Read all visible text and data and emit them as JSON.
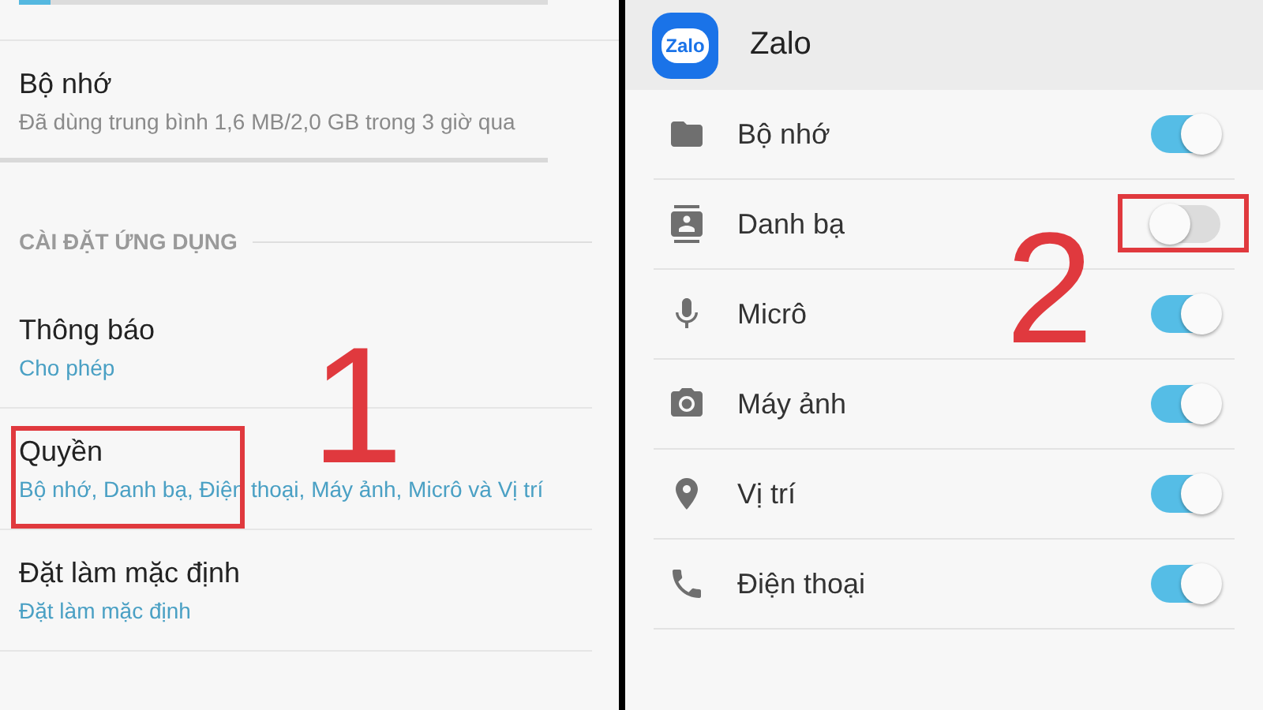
{
  "left_panel": {
    "usage_bar": {
      "level": 0.06
    },
    "items": [
      {
        "kind": "stat",
        "title": "Bộ nhớ",
        "subtitle": "Đã dùng trung bình 1,6 MB/2,0 GB trong 3 giờ qua",
        "highlighted": false
      },
      {
        "kind": "section",
        "title": "CÀI ĐẶT ỨNG DỤNG"
      },
      {
        "kind": "setting",
        "title": "Thông báo",
        "subtitle": "Cho phép",
        "highlighted": false
      },
      {
        "kind": "setting",
        "title": "Quyền",
        "subtitle": "Bộ nhớ, Danh bạ, Điện thoại, Máy ảnh, Micrô và Vị trí",
        "highlighted": true,
        "marker": "1"
      },
      {
        "kind": "setting",
        "title": "Đặt làm mặc định",
        "subtitle": "Đặt làm mặc định",
        "highlighted": false
      }
    ]
  },
  "right_panel": {
    "app": {
      "logo_text": "Zalo",
      "name": "Zalo"
    },
    "permissions": [
      {
        "label": "Bộ nhớ",
        "on": true,
        "highlighted": false
      },
      {
        "label": "Danh bạ",
        "on": false,
        "highlighted": true,
        "marker": "2"
      },
      {
        "label": "Micrô",
        "on": true,
        "highlighted": false
      },
      {
        "label": "Máy ảnh",
        "on": true,
        "highlighted": false
      },
      {
        "label": "Vị trí",
        "on": true,
        "highlighted": false
      },
      {
        "label": "Điện thoại",
        "on": true,
        "highlighted": false
      }
    ]
  }
}
